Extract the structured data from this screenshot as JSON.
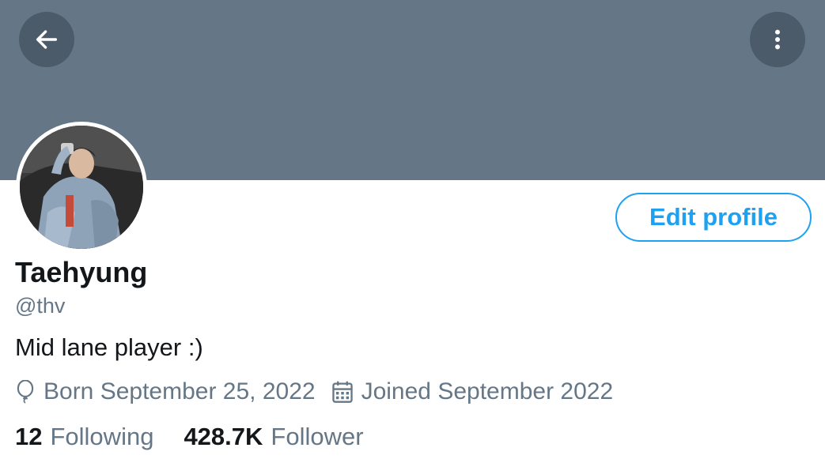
{
  "header": {
    "back_icon": "arrow-left-icon",
    "more_icon": "vertical-dots-icon",
    "banner_color": "#657786"
  },
  "profile": {
    "name": "Taehyung",
    "handle": "@thv",
    "bio": "Mid lane player :)",
    "born": "Born September 25, 2022",
    "joined": "Joined September 2022",
    "edit_label": "Edit profile",
    "following_count": "12",
    "following_label": "Following",
    "follower_count": "428.7K",
    "follower_label": "Follower"
  },
  "colors": {
    "accent": "#1da1f2",
    "secondary_text": "#657786",
    "primary_text": "#14171a"
  }
}
